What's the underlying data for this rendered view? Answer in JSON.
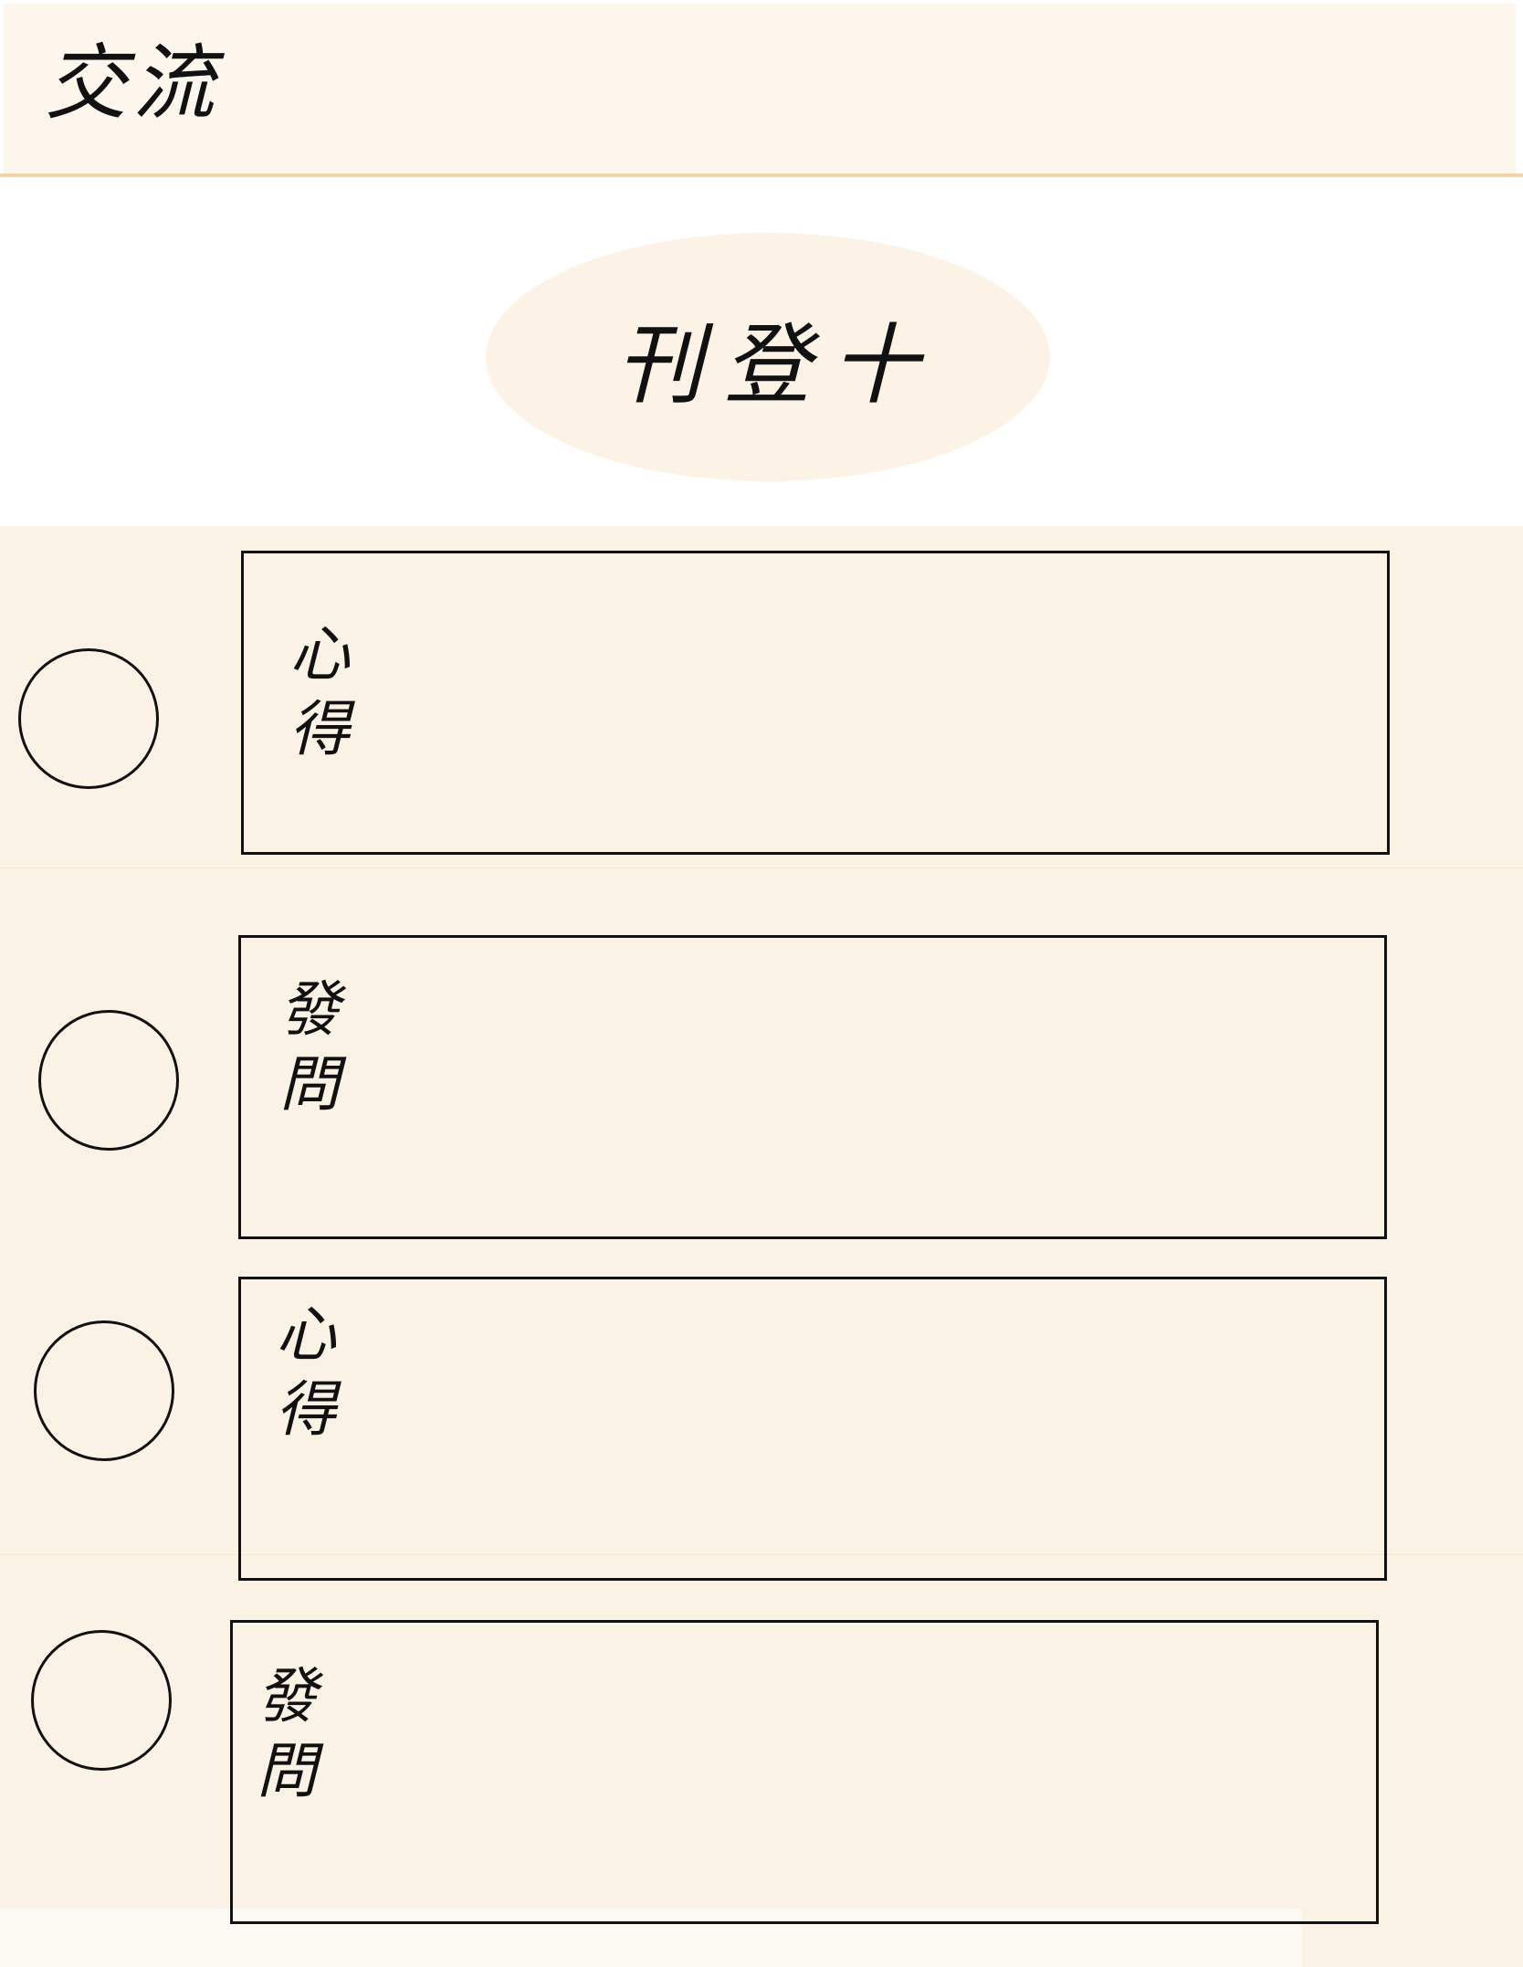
{
  "header": {
    "title": "交流"
  },
  "post_button": {
    "label": "刊登十"
  },
  "feed": {
    "items": [
      {
        "tag": "心得"
      },
      {
        "tag": "發問"
      },
      {
        "tag": "心得"
      },
      {
        "tag": "發問"
      }
    ]
  }
}
